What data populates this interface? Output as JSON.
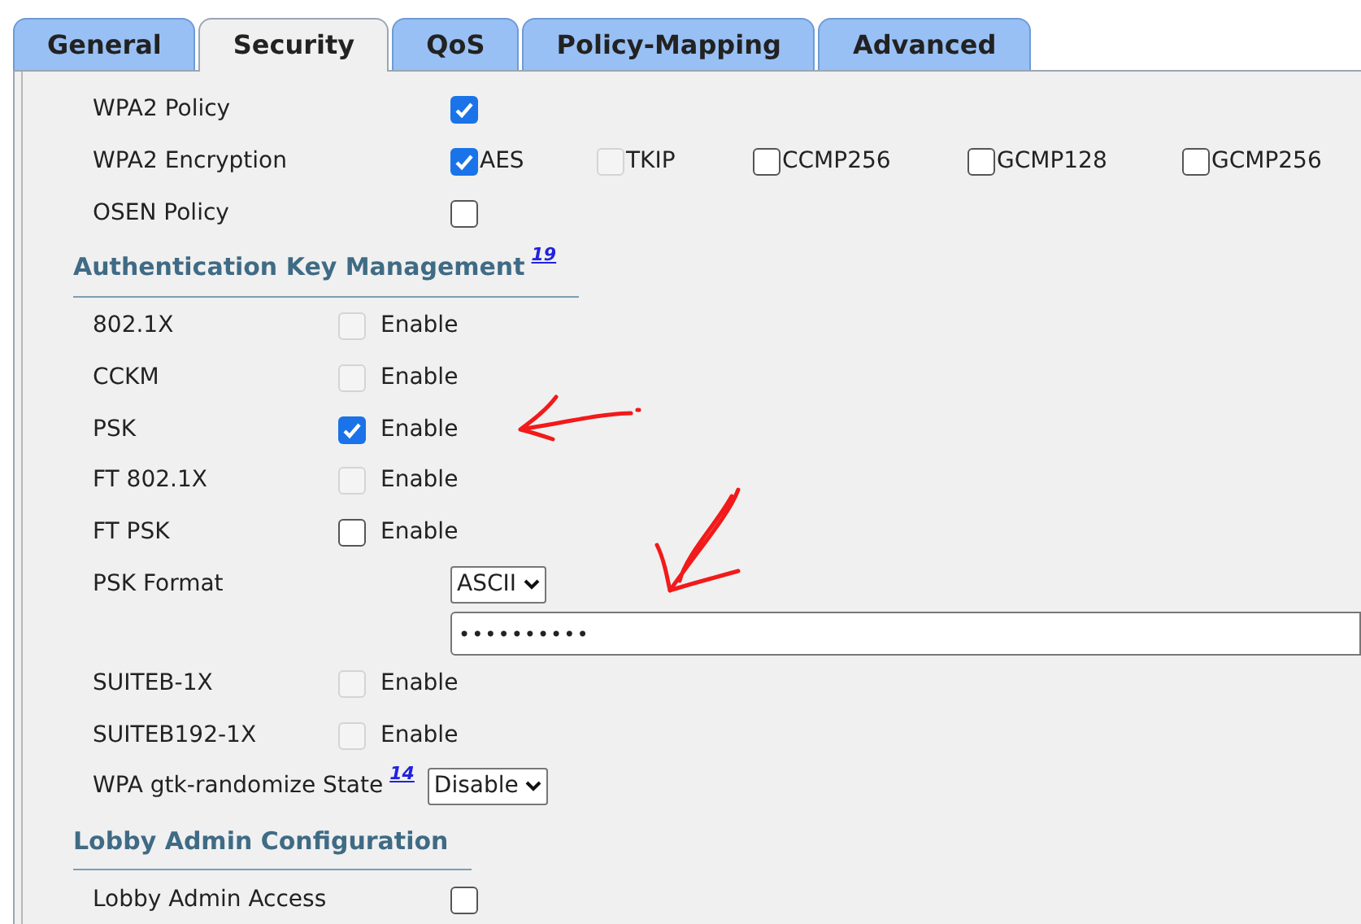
{
  "tabs": [
    {
      "label": "General",
      "selected": false
    },
    {
      "label": "Security",
      "selected": true
    },
    {
      "label": "QoS",
      "selected": false
    },
    {
      "label": "Policy-Mapping",
      "selected": false
    },
    {
      "label": "Advanced",
      "selected": false
    }
  ],
  "wpa2": [
    {
      "kind": "check",
      "label": "WPA2 Policy",
      "options": [
        {
          "checked": true,
          "disabled": false
        }
      ]
    },
    {
      "kind": "check",
      "label": "WPA2 Encryption",
      "options": [
        {
          "text": "AES",
          "checked": true,
          "disabled": false
        },
        {
          "text": "TKIP",
          "checked": false,
          "disabled": true
        },
        {
          "text": "CCMP256",
          "checked": false,
          "disabled": false
        },
        {
          "text": "GCMP128",
          "checked": false,
          "disabled": false
        },
        {
          "text": "GCMP256",
          "checked": false,
          "disabled": false
        }
      ]
    },
    {
      "kind": "check",
      "label": "OSEN Policy",
      "options": [
        {
          "checked": false,
          "disabled": false
        }
      ]
    }
  ],
  "akm_section": {
    "title": "Authentication Key Management",
    "footnote": "19"
  },
  "akm": [
    {
      "kind": "enable",
      "label": "802.1X",
      "option": "Enable",
      "checked": false,
      "disabled": true
    },
    {
      "kind": "enable",
      "label": "CCKM",
      "option": "Enable",
      "checked": false,
      "disabled": true
    },
    {
      "kind": "enable",
      "label": "PSK",
      "option": "Enable",
      "checked": true,
      "disabled": false
    },
    {
      "kind": "enable",
      "label": "FT 802.1X",
      "option": "Enable",
      "checked": false,
      "disabled": true
    },
    {
      "kind": "enable",
      "label": "FT PSK",
      "option": "Enable",
      "checked": false,
      "disabled": false
    },
    {
      "kind": "select",
      "label": "PSK Format",
      "value": "ASCII"
    },
    {
      "kind": "password",
      "value": "••••••••••"
    },
    {
      "kind": "enable",
      "label": "SUITEB-1X",
      "option": "Enable",
      "checked": false,
      "disabled": true
    },
    {
      "kind": "enable",
      "label": "SUITEB192-1X",
      "option": "Enable",
      "checked": false,
      "disabled": true
    },
    {
      "kind": "select",
      "label": "WPA gtk-randomize State",
      "footnote": "14",
      "value": "Disable"
    }
  ],
  "lobby_section": {
    "title": "Lobby Admin Configuration"
  },
  "lobby": [
    {
      "kind": "check",
      "label": "Lobby Admin Access",
      "options": [
        {
          "checked": false,
          "disabled": false
        }
      ]
    }
  ]
}
